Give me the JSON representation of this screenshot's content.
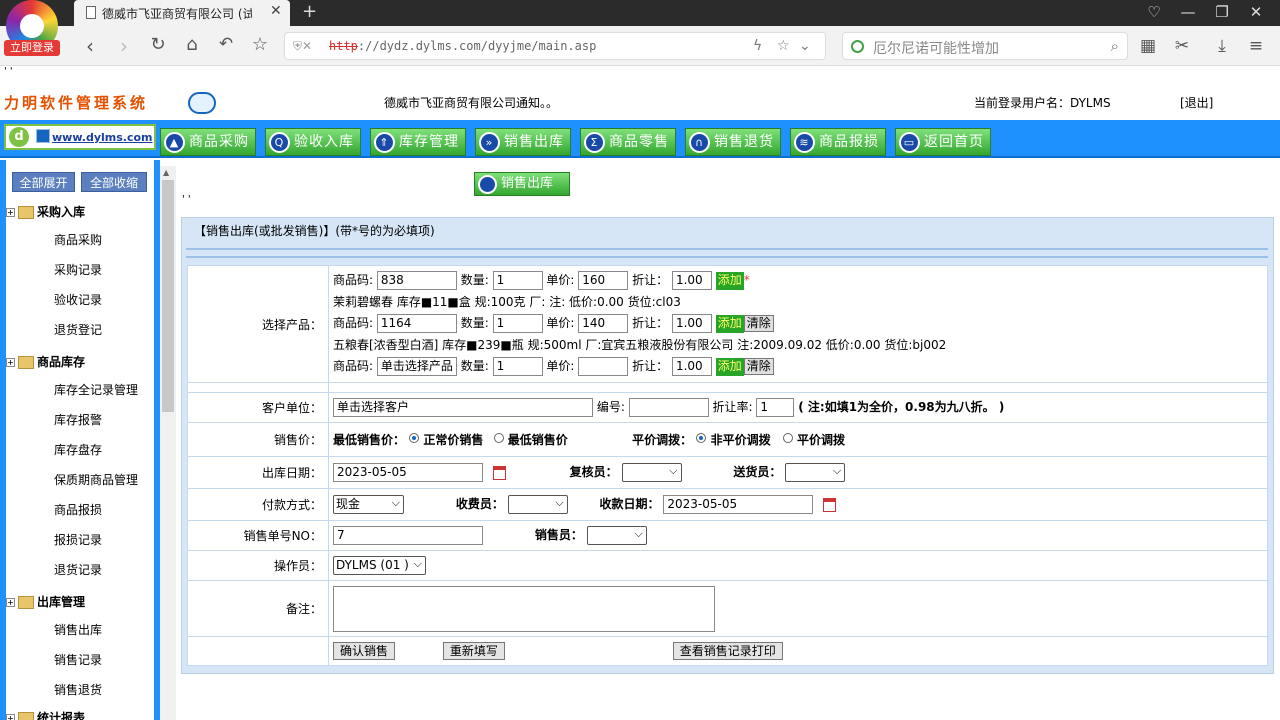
{
  "browser": {
    "tab_title": "德威市飞亚商贸有限公司 (试用",
    "login_badge": "立即登录",
    "url_scheme": "http",
    "url_rest": "://dydz.dylms.com/dyyjme/main.asp",
    "search_placeholder": "厄尔尼诺可能性增加"
  },
  "header": {
    "top_strip": "' '",
    "system_name": "力明软件管理系统",
    "notice": "德威市飞亚商贸有限公司通知。。",
    "current_user": "当前登录用户名：DYLMS",
    "logout": "[退出]",
    "site_url": "www.dylms.com"
  },
  "menu": [
    {
      "label": "商品采购",
      "icon": "cart-icon"
    },
    {
      "label": "验收入库",
      "icon": "search-icon"
    },
    {
      "label": "库存管理",
      "icon": "arrow-up-icon"
    },
    {
      "label": "销售出库",
      "icon": "forward-icon"
    },
    {
      "label": "商品零售",
      "icon": "sigma-icon"
    },
    {
      "label": "销售退货",
      "icon": "return-icon"
    },
    {
      "label": "商品报损",
      "icon": "report-icon"
    },
    {
      "label": "返回首页",
      "icon": "home-icon"
    }
  ],
  "sidebar": {
    "expand_all": "全部展开",
    "collapse_all": "全部收缩",
    "groups": [
      {
        "title": "采购入库",
        "items": [
          "商品采购",
          "采购记录",
          "验收记录",
          "退货登记"
        ]
      },
      {
        "title": "商品库存",
        "items": [
          "库存全记录管理",
          "库存报警",
          "库存盘存",
          "保质期商品管理",
          "商品报损",
          "报损记录",
          "退货记录"
        ]
      },
      {
        "title": "出库管理",
        "items": [
          "销售出库",
          "销售记录",
          "销售退货"
        ]
      },
      {
        "title": "统计报表",
        "items": []
      }
    ]
  },
  "content": {
    "page_button": "销售出库",
    "quotes": "' '",
    "form_title": "【销售出库(或批发销售)】(带*号的为必填项)",
    "labels": {
      "select_product": "选择产品：",
      "code": "商品码:",
      "qty": "数量:",
      "price": "单价:",
      "discount": "折让：",
      "add": "添加",
      "clear": "清除",
      "customer": "客户单位：",
      "number": "编号:",
      "discount_rate": "折让率:",
      "discount_note": "( 注:如填1为全价，0.98为九八折。 )",
      "sale_price": "销售价：",
      "min_price": "最低销售价：",
      "normal_price": "正常价销售",
      "lowest_price": "最低销售价",
      "transfer": "平价调拨：",
      "non_transfer": "非平价调拨",
      "flat_transfer": "平价调拨",
      "out_date": "出库日期：",
      "checker": "复核员：",
      "deliverer": "送货员：",
      "payment": "付款方式：",
      "cashier": "收费员：",
      "pay_date": "收款日期：",
      "order_no": "销售单号NO：",
      "salesman": "销售员：",
      "operator": "操作员：",
      "remark": "备注："
    },
    "products": [
      {
        "code": "838",
        "qty": "1",
        "price": "160",
        "discount": "1.00",
        "info": "茉莉碧螺春  库存■11■盒    规:100克 厂: 注: 低价:0.00 货位:cl03"
      },
      {
        "code": "1164",
        "qty": "1",
        "price": "140",
        "discount": "1.00",
        "info": "五粮春[浓香型白酒]  库存■239■瓶    规:500ml 厂:宜宾五粮液股份有限公司 注:2009.09.02 低价:0.00 货位:bj002"
      },
      {
        "code": "单击选择产品",
        "qty": "1",
        "price": "",
        "discount": "1.00"
      }
    ],
    "customer_value": "单击选择客户",
    "number_value": "",
    "discount_rate_value": "1",
    "out_date_value": "2023-05-05",
    "payment_value": "现金",
    "pay_date_value": "2023-05-05",
    "order_no_value": "7",
    "operator_value": "DYLMS (01 )",
    "buttons": {
      "confirm": "确认销售",
      "reset": "重新填写",
      "view_print": "查看销售记录打印"
    }
  },
  "colors": {
    "menu_blue": "#1e90ff",
    "button_green": "#33a62f",
    "panel_bg": "#d6e6f6"
  }
}
